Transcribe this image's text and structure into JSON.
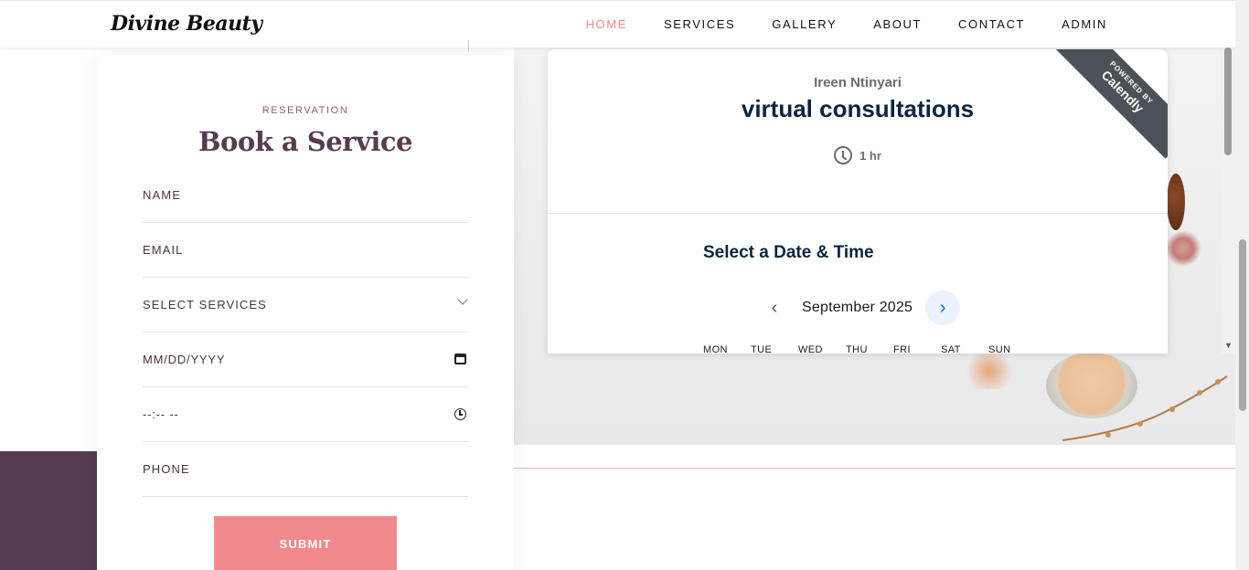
{
  "brand": {
    "logo_text": "Divine Beauty"
  },
  "nav": {
    "items": [
      {
        "label": "HOME",
        "active": true
      },
      {
        "label": "SERVICES",
        "active": false
      },
      {
        "label": "GALLERY",
        "active": false
      },
      {
        "label": "ABOUT",
        "active": false
      },
      {
        "label": "CONTACT",
        "active": false
      },
      {
        "label": "ADMIN",
        "active": false
      }
    ]
  },
  "reservation": {
    "kicker": "RESERVATION",
    "title": "Book a Service",
    "fields": {
      "name": "NAME",
      "email": "EMAIL",
      "services": "SELECT SERVICES",
      "date_placeholder": "MM/DD/YYYY",
      "time_placeholder": "--:-- --",
      "phone": "PHONE"
    },
    "submit_label": "SUBMIT"
  },
  "calendly": {
    "owner": "Ireen Ntinyari",
    "event": "virtual consultations",
    "duration": "1 hr",
    "ribbon_small": "POWERED BY",
    "ribbon_big": "Calendly",
    "select_heading": "Select a Date & Time",
    "month": "September 2025",
    "weekdays": [
      "MON",
      "TUE",
      "WED",
      "THU",
      "FRI",
      "SAT",
      "SUN"
    ]
  },
  "colors": {
    "accent_pink": "#f08a8d",
    "plum": "#573b4e",
    "calendly_navy": "#0a2540",
    "calendly_blue": "#0069ff"
  }
}
